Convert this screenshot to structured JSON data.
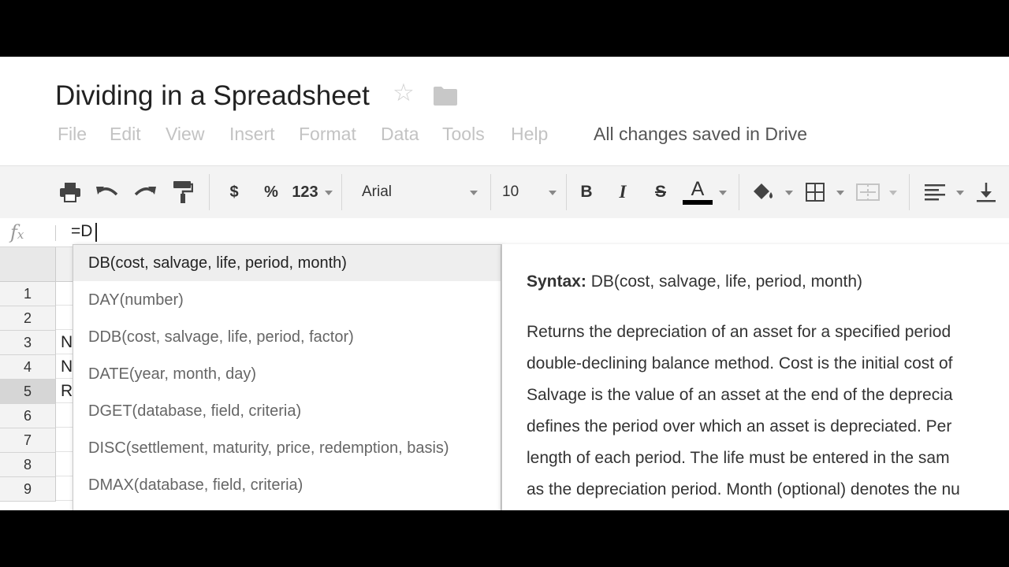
{
  "document": {
    "title": "Dividing in a Spreadsheet",
    "save_status": "All changes saved in Drive"
  },
  "menu": [
    "File",
    "Edit",
    "View",
    "Insert",
    "Format",
    "Data",
    "Tools",
    "Help"
  ],
  "toolbar": {
    "currency_label": "$",
    "percent_label": "%",
    "number_format_label": "123",
    "font_name": "Arial",
    "font_size": "10",
    "bold_label": "B",
    "italic_label": "I",
    "strike_label": "S",
    "text_color_label": "A",
    "text_color": "#000000"
  },
  "formula_bar": {
    "fx_label": "fx",
    "value": "=D"
  },
  "rows": [
    {
      "num": "1",
      "cell": ""
    },
    {
      "num": "2",
      "cell": ""
    },
    {
      "num": "3",
      "cell": "N"
    },
    {
      "num": "4",
      "cell": "N"
    },
    {
      "num": "5",
      "cell": "R"
    },
    {
      "num": "6",
      "cell": ""
    },
    {
      "num": "7",
      "cell": ""
    },
    {
      "num": "8",
      "cell": ""
    },
    {
      "num": "9",
      "cell": ""
    }
  ],
  "active_row": "5",
  "suggestions": [
    "DB(cost, salvage, life, period, month)",
    "DAY(number)",
    "DDB(cost, salvage, life, period, factor)",
    "DATE(year, month, day)",
    "DGET(database, field, criteria)",
    "DISC(settlement, maturity, price, redemption, basis)",
    "DMAX(database, field, criteria)"
  ],
  "help": {
    "syntax_label": "Syntax:",
    "syntax_value": "DB(cost, salvage, life, period, month)",
    "description_lines": [
      "Returns the depreciation of an asset for a specified period",
      "double-declining balance method. Cost is the initial cost of",
      "Salvage is the value of an asset at the end of the deprecia",
      "defines the period over which an asset is depreciated. Per",
      "length of each period. The life must be entered in the sam",
      "as the depreciation period. Month (optional) denotes the nu"
    ]
  },
  "icons": {
    "star": "star-outline-icon",
    "folder": "folder-icon",
    "print": "print-icon",
    "undo": "undo-icon",
    "redo": "redo-icon",
    "paint_format": "paint-format-icon",
    "fill_color": "fill-color-icon",
    "borders": "borders-icon",
    "merge": "merge-cells-icon",
    "align": "align-left-icon",
    "valign": "vertical-align-bottom-icon"
  }
}
